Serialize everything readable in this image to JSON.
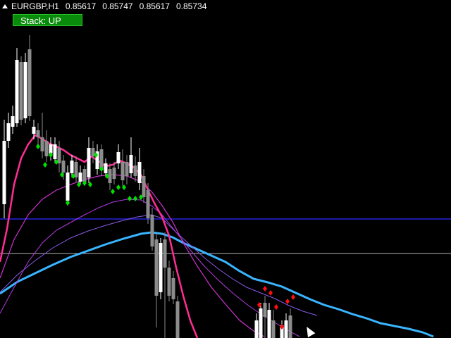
{
  "header": {
    "symbol": "EURGBP,H1",
    "open": "0.85617",
    "high": "0.85747",
    "low": "0.85617",
    "close": "0.85734"
  },
  "stack_button": {
    "label": "Stack: UP"
  },
  "colors": {
    "background": "#000000",
    "bull_candle": "#ffffff",
    "bear_candle": "#8c8c8c",
    "ma_fast": "#ff2d95",
    "ma_mid": "#cc33cc",
    "ma_slow": "#9b4de0",
    "ma_slowest": "#3ab4ff",
    "buy_arrow": "#00e000",
    "sell_arrow": "#ff1010",
    "level_blue": "#1a1aa8",
    "level_gray": "#b4b4b4",
    "stack_button_bg": "#0a8a0a"
  }
}
